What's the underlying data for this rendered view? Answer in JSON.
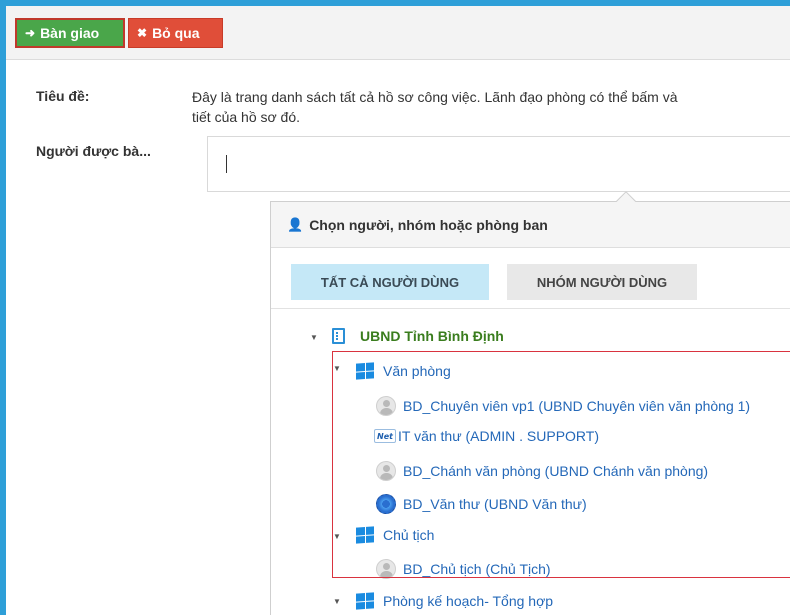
{
  "toolbar": {
    "handover_label": "Bàn giao",
    "skip_label": "Bỏ qua"
  },
  "form": {
    "title_label": "Tiêu đề:",
    "title_text_line1": "Đây là trang danh sách tất cả hồ sơ công việc. Lãnh đạo phòng có thể bấm và",
    "title_text_line2": "tiết của hồ sơ đó.",
    "recipient_label": "Người được bà...",
    "recipient_value": ""
  },
  "picker": {
    "header": "Chọn người, nhóm hoặc phòng ban",
    "tabs": [
      {
        "label": "TẤT CẢ NGƯỜI DÙNG",
        "active": true
      },
      {
        "label": "NHÓM NGƯỜI DÙNG",
        "active": false
      }
    ],
    "tree": {
      "root": {
        "label": "UBND Tỉnh Bình Định",
        "icon": "building-icon"
      },
      "groups": [
        {
          "label": "Văn phòng",
          "icon": "windows-icon",
          "members": [
            {
              "label": "BD_Chuyên viên vp1 (UBND Chuyên viên văn phòng 1)",
              "icon": "avatar-icon"
            },
            {
              "label": "IT văn thư (ADMIN . SUPPORT)",
              "icon": "logo-icon"
            },
            {
              "label": "BD_Chánh văn phòng (UBND Chánh văn phòng)",
              "icon": "avatar-icon"
            },
            {
              "label": "BD_Văn thư (UBND Văn thư)",
              "icon": "seal-icon"
            }
          ]
        },
        {
          "label": "Chủ tịch",
          "icon": "windows-icon",
          "members": [
            {
              "label": "BD_Chủ tịch (Chủ Tịch)",
              "icon": "avatar-icon"
            }
          ]
        },
        {
          "label": "Phòng kế hoạch- Tổng hợp",
          "icon": "windows-icon",
          "members": []
        }
      ]
    }
  },
  "colors": {
    "frame": "#2e9fd8",
    "primary_button": "#4aa64a",
    "danger_button": "#e04e39",
    "root_text": "#3a7d1e",
    "link_text": "#2468b8",
    "highlight_border": "#d9333f",
    "active_tab": "#c5e8f7"
  }
}
